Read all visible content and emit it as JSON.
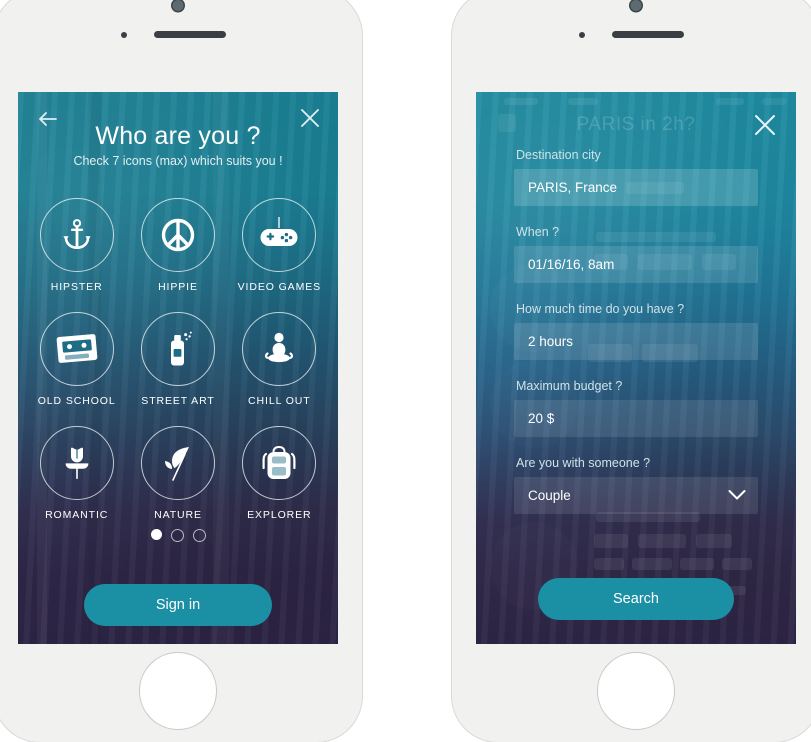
{
  "screen_one": {
    "back_icon": "arrow-left-icon",
    "close_icon": "close-icon",
    "title": "Who are you ?",
    "subtitle": "Check 7 icons (max) which suits you !",
    "items": [
      {
        "label": "HIPSTER",
        "icon": "anchor-icon"
      },
      {
        "label": "HIPPIE",
        "icon": "peace-sign-icon"
      },
      {
        "label": "VIDEO GAMES",
        "icon": "gamepad-icon"
      },
      {
        "label": "OLD SCHOOL",
        "icon": "cassette-tape-icon"
      },
      {
        "label": "STREET ART",
        "icon": "spray-can-icon"
      },
      {
        "label": "CHILL OUT",
        "icon": "meditation-icon"
      },
      {
        "label": "ROMANTIC",
        "icon": "rose-icon"
      },
      {
        "label": "NATURE",
        "icon": "leaf-icon"
      },
      {
        "label": "EXPLORER",
        "icon": "backpack-icon"
      }
    ],
    "pagination": {
      "total": 3,
      "active": 1
    },
    "cta_label": "Sign in"
  },
  "screen_two": {
    "close_icon": "close-icon",
    "background_title": "PARIS in 2h?",
    "fields": [
      {
        "label": "Destination city",
        "value": "PARIS, France",
        "type": "text"
      },
      {
        "label": "When ?",
        "value": "01/16/16, 8am",
        "type": "text"
      },
      {
        "label": "How much time do you have ?",
        "value": "2 hours",
        "type": "text"
      },
      {
        "label": "Maximum budget ?",
        "value": "20 $",
        "type": "text"
      },
      {
        "label": "Are you with someone ?",
        "value": "Couple",
        "type": "select",
        "chevron": "chevron-down-icon"
      }
    ],
    "cta_label": "Search"
  },
  "colors": {
    "accent_teal": "#1b90a5",
    "frame_teal": "#1d8ca1",
    "screen_top": "#1b8094",
    "screen_bottom": "#2c2444",
    "bezel": "#f1f1f0"
  }
}
